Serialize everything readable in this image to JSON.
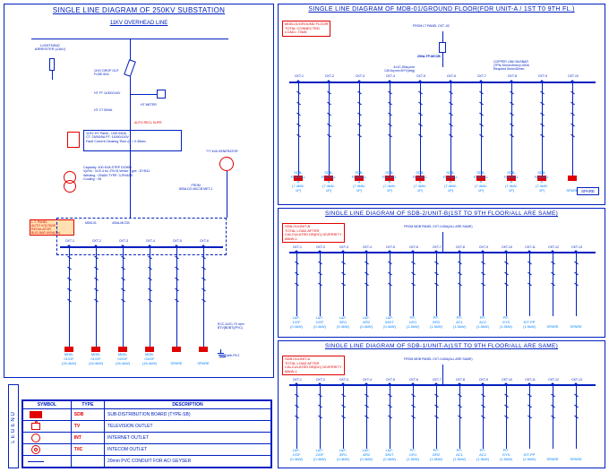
{
  "panels": {
    "main": {
      "title": "SINGLE LINE DIAGRAM OF 250KV SUBSTATION",
      "overhead": "11KV OVERHEAD LINE",
      "arrester": "LIGHTNING\nARRESTER (11kV)",
      "dropout": "11KV DROP OUT\nFUSE 60A",
      "htPt": "HT PT 11000/110V",
      "htCt": "HT CT 50/5A",
      "htMeter": "HT METER",
      "autoReclose": "AUTO RECL SUPR",
      "panel11kv": "11KV HT Panel - LBS 630A\nCT: 25/50/5A  PT: 11000/110V\nFault Current Clearing Time (t) = 0.45sec",
      "xfmr": "Capacity: 400 KVA  STEP DOWN\nVp/Vs    : 11/0.4 kv, Z%=5,Vector Type : DYN11\nWinding : ONAN  TYPE: 3-PHASE\nCooling  : Oil",
      "gen": "??? kVA GENERATOR",
      "fromPanel": "FROM\n800A-DO-MCCB MET-1",
      "ltPanelBox": "L.T. PANEL\nAUTO VOLTAGE REGULATOR\nBUS-BAR 800A(Cu)",
      "mdb01": "MDB-01",
      "mccb400": "400A-MCCB",
      "cables": "ECC-2x2C-70 mm²\nBTV(BDBT)(PVC)",
      "earthPit": "Earth Pit 2",
      "ltFeeders": [
        {
          "id": "CKT-1",
          "label": "MDB-01/GF\n(16.4kW)"
        },
        {
          "id": "CKT-2",
          "label": "MDB-01/GF\n(16.4kW)"
        },
        {
          "id": "CKT-3",
          "label": "MDB-02/GF\n(16.4kW)"
        },
        {
          "id": "CKT-4",
          "label": "MDB-03/GF\n(16.4kW)"
        },
        {
          "id": "CKT-5",
          "label": "SPARE"
        },
        {
          "id": "CKT-6",
          "label": "SPARE"
        }
      ]
    },
    "mdb": {
      "title": "SINGLE LINE DIAGRAM OF MDB-01/GROUND FLOOR(FOR UNIT-A / 1ST T0 9TH FL.)",
      "from": "FROM LT PANEL CKT.-02",
      "loadBox": "MDB-01/GROUND FLOOR\nTOTAL CONNECTED\nLOAD= 70kW",
      "mccb": "200A-TP-MCCB",
      "busbar": "COPPER LINK BUSBAR\n(TPN-20mmx5mm)=400A\nRequired 5mmx30mm",
      "cable": "4x1C-50sq.mm\n135.5q.mm BYY(cblg)",
      "feeders": [
        {
          "id": "CKT-1",
          "label": "SDB-FL#01/U-A\n(7.4kW-1P)"
        },
        {
          "id": "CKT-2",
          "label": "SDB-FL#02/U-A\n(7.4kW-1P)"
        },
        {
          "id": "CKT-3",
          "label": "SDB-FL#03/U-A\n(7.4kW-1P)"
        },
        {
          "id": "CKT-4",
          "label": "SDB-FL#04/U-A\n(7.4kW-1P)"
        },
        {
          "id": "CKT-5",
          "label": "SDB-FL#05/U-A\n(7.4kW-1P)"
        },
        {
          "id": "CKT-6",
          "label": "SDB-FL#06/U-A\n(7.4kW-1P)"
        },
        {
          "id": "CKT-7",
          "label": "SDB-FL#07/U-A\n(7.4kW-1P)"
        },
        {
          "id": "CKT-8",
          "label": "SDB-FL#08/U-A\n(7.4kW-1P)"
        },
        {
          "id": "CKT-9",
          "label": "SDB-FL#09/U-A\n(7.4kW-1P)"
        },
        {
          "id": "CKT-10",
          "label": "SPARE"
        }
      ],
      "deviceLabel": "40A-TP-MCCB",
      "spare": "SPARE"
    },
    "sdb2": {
      "title": "SINGLE LINE DIAGRAM OF SDB-2/UNIT-B(1ST TO 9TH FLOOR/ALL ARE SAME)",
      "loadBox": "SDB-01/UNIT-B\nTOTAL LOAD AFTER\nCALCULATED  DB(DC) DIVERSITY\n68kW-1",
      "from": "FROM MDB PANEL CKT-1/40A(ALL ARE SAME)",
      "feeders": [
        {
          "id": "CKT-1",
          "label": "L&F-1/GF\n(0.4kW)"
        },
        {
          "id": "CKT-2",
          "label": "L&F-2/GF\n(0.4kW)"
        },
        {
          "id": "CKT-3",
          "label": "L&F-3/R1\n(0.4kW)"
        },
        {
          "id": "CKT-4",
          "label": "L&F-4/R2\n(0.4kW)"
        },
        {
          "id": "CKT-5",
          "label": "L&F-5/KIT\n(0.4kW)"
        },
        {
          "id": "CKT-6",
          "label": "PP-1/R1\n(1.5kW)"
        },
        {
          "id": "CKT-7",
          "label": "PP-2/R2\n(1.5kW)"
        },
        {
          "id": "CKT-8",
          "label": "PP-AC1\n(1.5kW)"
        },
        {
          "id": "CKT-9",
          "label": "PP-AC2\n(1.5kW)"
        },
        {
          "id": "CKT-10",
          "label": "PP-GYS\n(1.5kW)"
        },
        {
          "id": "CKT-11",
          "label": "KIT-PP\n(1.5kW)"
        },
        {
          "id": "CKT-12",
          "label": "SPARE"
        },
        {
          "id": "CKT-13",
          "label": "SPARE"
        }
      ]
    },
    "sdb1": {
      "title": "SINGLE LINE DIAGRAM OF SDB-1/UNIT-A(1ST TO 9TH FLOOR/ALL ARE SAME)",
      "loadBox": "SDB-01/UNIT-A\nTOTAL LOAD AFTER\nCALCULATED  DB(DC) DIVERSITY\n68kW-1",
      "from": "FROM MDB PANEL CKT-1/40A(ALL ARE SAME)",
      "feeders": [
        {
          "id": "CKT-1",
          "label": "L&F-1/GF\n(0.4kW)"
        },
        {
          "id": "CKT-2",
          "label": "L&F-2/GF\n(0.4kW)"
        },
        {
          "id": "CKT-3",
          "label": "L&F-3/R1\n(0.4kW)"
        },
        {
          "id": "CKT-4",
          "label": "L&F-4/R2\n(0.4kW)"
        },
        {
          "id": "CKT-5",
          "label": "L&F-5/KIT\n(0.4kW)"
        },
        {
          "id": "CKT-6",
          "label": "PP-1/R1\n(1.5kW)"
        },
        {
          "id": "CKT-7",
          "label": "PP-2/R2\n(1.5kW)"
        },
        {
          "id": "CKT-8",
          "label": "PP-AC1\n(1.5kW)"
        },
        {
          "id": "CKT-9",
          "label": "PP-AC2\n(1.5kW)"
        },
        {
          "id": "CKT-10",
          "label": "PP-GYS\n(1.5kW)"
        },
        {
          "id": "CKT-11",
          "label": "KIT-PP\n(1.5kW)"
        },
        {
          "id": "CKT-12",
          "label": "SPARE"
        },
        {
          "id": "CKT-13",
          "label": "SPARE"
        }
      ]
    }
  },
  "legend": {
    "side": "LEGEND",
    "head": [
      "SYMBOL",
      "TYPE",
      "DESCRIPTION"
    ],
    "rows": [
      {
        "type": "SDB",
        "desc": "SUB-DISTRIBUTION BOARD (TYPE-SB)"
      },
      {
        "type": "TV",
        "desc": "TELEVISION OUTLET"
      },
      {
        "type": "INT",
        "desc": "INTERNET OUTLET"
      },
      {
        "type": "T/IC",
        "desc": "INTECOM OUTLET"
      },
      {
        "type": "",
        "desc": "20mm PVC CONDUIT FOR AC/ GEYSER"
      }
    ]
  }
}
